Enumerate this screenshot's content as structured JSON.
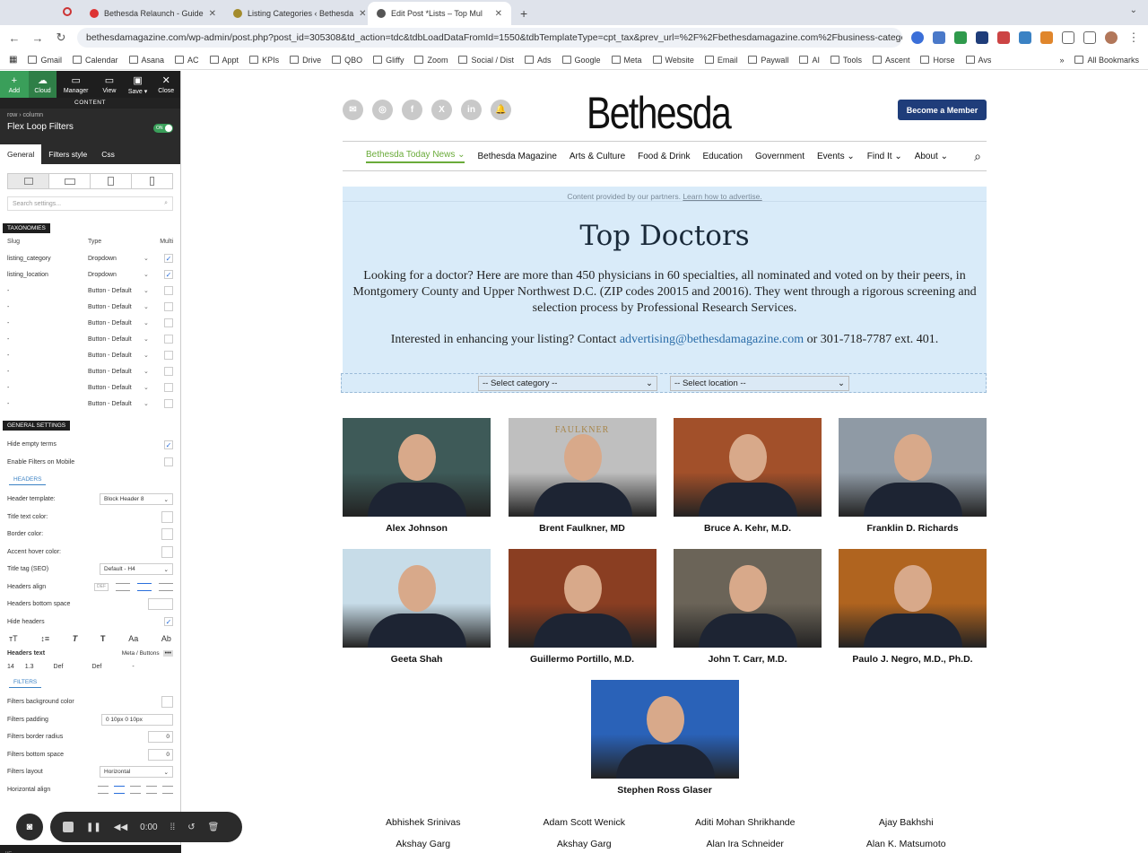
{
  "browser": {
    "tabs": [
      {
        "title": "Bethesda Relaunch - Guide"
      },
      {
        "title": "Listing Categories ‹ Bethesda"
      },
      {
        "title": "Edit Post *Lists – Top Mul"
      }
    ],
    "url": "bethesdamagazine.com/wp-admin/post.php?post_id=305308&td_action=tdc&tdbLoadDataFromId=1550&tdbTemplateType=cpt_tax&prev_url=%2F%2Fbethesdamagazine.com%2Fbusiness-catego...",
    "bookmarks": [
      "Gmail",
      "Calendar",
      "Asana",
      "AC",
      "Appt",
      "KPIs",
      "Drive",
      "QBO",
      "Gliffy",
      "Zoom",
      "Social / Dist",
      "Ads",
      "Google",
      "Meta",
      "Website",
      "Email",
      "Paywall",
      "AI",
      "Tools",
      "Ascent",
      "Horse",
      "Avs"
    ],
    "all_bookmarks": "All Bookmarks",
    "more": "»"
  },
  "editor": {
    "toolbar": {
      "add": "Add",
      "cloud": "Cloud",
      "manager": "Manager",
      "view": "View",
      "save": "Save ▾",
      "close": "Close"
    },
    "content_label": "CONTENT",
    "breadcrumb": "row › column",
    "title": "Flex Loop Filters",
    "toggle": "ON",
    "tabs": [
      "General",
      "Filters style",
      "Css"
    ],
    "search_placeholder": "Search settings...",
    "taxonomies_label": "TAXONOMIES",
    "tax_head": {
      "slug": "Slug",
      "type": "Type",
      "multi": "Multi"
    },
    "tax_rows": [
      {
        "slug": "listing_category",
        "type": "Dropdown",
        "multi": "✓"
      },
      {
        "slug": "listing_location",
        "type": "Dropdown",
        "multi": "✓"
      },
      {
        "slug": "-",
        "type": "Button - Default",
        "multi": ""
      },
      {
        "slug": "-",
        "type": "Button - Default",
        "multi": ""
      },
      {
        "slug": "-",
        "type": "Button - Default",
        "multi": ""
      },
      {
        "slug": "-",
        "type": "Button - Default",
        "multi": ""
      },
      {
        "slug": "-",
        "type": "Button - Default",
        "multi": ""
      },
      {
        "slug": "-",
        "type": "Button - Default",
        "multi": ""
      },
      {
        "slug": "-",
        "type": "Button - Default",
        "multi": ""
      },
      {
        "slug": "-",
        "type": "Button - Default",
        "multi": ""
      }
    ],
    "general_label": "GENERAL SETTINGS",
    "hide_empty": "Hide empty terms",
    "enable_mobile": "Enable Filters on Mobile",
    "headers_label": "HEADERS",
    "header_template": "Header template:",
    "header_template_val": "Block Header 8",
    "title_text_color": "Title text color:",
    "border_color": "Border color:",
    "accent_hover": "Accent hover color:",
    "title_tag": "Title tag (SEO)",
    "title_tag_val": "Default - H4",
    "headers_align": "Headers align",
    "headers_align_def": "DEF",
    "headers_bottom": "Headers bottom space",
    "hide_headers": "Hide headers",
    "headers_text": "Headers text",
    "meta_buttons": "Meta / Buttons",
    "ht_values": [
      "14",
      "1.3",
      "Def",
      "Def",
      "-"
    ],
    "filters_label": "FILTERS",
    "filters_bg": "Filters background color",
    "filters_padding": "Filters padding",
    "filters_padding_val": "0 10px 0 10px",
    "filters_radius": "Filters border radius",
    "filters_radius_val": "0",
    "filters_bottom": "Filters bottom space",
    "filters_bottom_val": "0",
    "filters_layout": "Filters layout",
    "filters_layout_val": "Horizontal",
    "horizontal_align": "Horizontal align",
    "vc_label": "VC"
  },
  "recorder": {
    "time": "0:00"
  },
  "site": {
    "logo": "Bethesda",
    "member_button": "Become a Member",
    "nav": [
      "Bethesda Today News ⌄",
      "Bethesda Magazine",
      "Arts & Culture",
      "Food & Drink",
      "Education",
      "Government",
      "Events ⌄",
      "Find It ⌄",
      "About ⌄"
    ],
    "partner_note": "Content provided by our partners.",
    "partner_link": "Learn how to advertise.",
    "title": "Top Doctors",
    "description": "Looking for a doctor? Here are more than 450 physicians in 60 specialties, all nominated and voted on by their peers, in Montgomery County and Upper Northwest D.C. (ZIP codes 20015 and 20016). They went through a rigorous screening and selection process by Professional Research Services.",
    "contact_prefix": "Interested in enhancing your listing? Contact ",
    "contact_email": "advertising@bethesdamagazine.com",
    "contact_suffix": " or 301-718-7787 ext. 401.",
    "select_category": "-- Select category --",
    "select_location": "-- Select location --",
    "faulkner_logo": "FAULKNER",
    "doctors": [
      {
        "name": "Alex Johnson",
        "color": "#3e5a58"
      },
      {
        "name": "Brent Faulkner, MD",
        "color": "#bfbfbf"
      },
      {
        "name": "Bruce A. Kehr, M.D.",
        "color": "#a2502a"
      },
      {
        "name": "Franklin D. Richards",
        "color": "#8f9aa5"
      },
      {
        "name": "Geeta Shah",
        "color": "#c7dce8"
      },
      {
        "name": "Guillermo Portillo, M.D.",
        "color": "#8a3e22"
      },
      {
        "name": "John T. Carr, M.D.",
        "color": "#6b6458"
      },
      {
        "name": "Paulo J. Negro, M.D., Ph.D.",
        "color": "#b0641f"
      },
      {
        "name": "Stephen Ross Glaser",
        "color": "#2a62b8"
      }
    ],
    "others": [
      "Abhishek Srinivas",
      "Adam Scott Wenick",
      "Aditi Mohan Shrikhande",
      "Ajay Bakhshi",
      "Akshay Garg",
      "Akshay Garg",
      "Alan Ira Schneider",
      "Alan K. Matsumoto"
    ]
  }
}
